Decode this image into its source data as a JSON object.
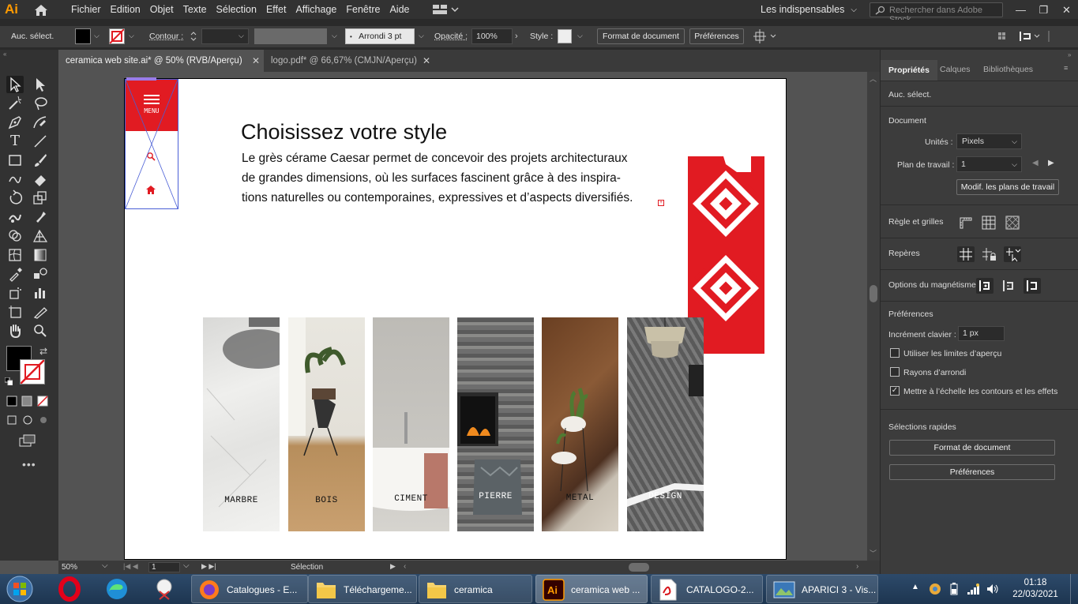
{
  "app": {
    "logo": "Ai",
    "accent": "#ff9a00"
  },
  "menubar": {
    "items": [
      "Fichier",
      "Edition",
      "Objet",
      "Texte",
      "Sélection",
      "Effet",
      "Affichage",
      "Fenêtre",
      "Aide"
    ],
    "workspace": "Les indispensables",
    "search_placeholder": "Rechercher dans Adobe Stock"
  },
  "control_bar": {
    "selection_label": "Auc. sélect.",
    "contour_label": "Contour :",
    "brush": "Arrondi 3 pt",
    "opacity_label": "Opacité :",
    "opacity_value": "100%",
    "style_label": "Style :",
    "doc_format_button": "Format de document",
    "preferences_button": "Préférences"
  },
  "tabs": [
    {
      "label": "ceramica web site.ai* @ 50% (RVB/Aperçu)",
      "active": true
    },
    {
      "label": "logo.pdf* @ 66,67% (CMJN/Aperçu)",
      "active": false
    }
  ],
  "artboard": {
    "menu_label": "MENU",
    "title": "Choisissez votre style",
    "body_lines": [
      "Le grès cérame Caesar permet de concevoir des projets architecturaux",
      "de grandes dimensions, où les surfaces fascinent grâce à des inspira-",
      "tions naturelles ou contemporaines, expressives et d’aspects diversifiés."
    ],
    "brand_color": "#e11b22",
    "tiles": [
      {
        "label": "MARBRE",
        "kind": "marble"
      },
      {
        "label": "BOIS",
        "kind": "wood"
      },
      {
        "label": "CIMENT",
        "kind": "cement"
      },
      {
        "label": "PIERRE",
        "kind": "stone"
      },
      {
        "label": "METAL",
        "kind": "metal"
      },
      {
        "label": "DESIGN",
        "kind": "design"
      }
    ]
  },
  "status": {
    "zoom": "50%",
    "artboard_num": "1",
    "tool": "Sélection"
  },
  "panel": {
    "tabs": [
      "Propriétés",
      "Calques",
      "Bibliothèques"
    ],
    "selection": "Auc. sélect.",
    "document_title": "Document",
    "units_label": "Unités :",
    "units_value": "Pixels",
    "artboard_label": "Plan de travail :",
    "artboard_value": "1",
    "modify_artboards": "Modif. les plans de travail",
    "rulers_grids": "Règle et grilles",
    "guides": "Repères",
    "snap_options": "Options du magnétisme",
    "preferences_title": "Préférences",
    "keyboard_increment_label": "Incrément clavier :",
    "keyboard_increment_value": "1 px",
    "checkboxes": [
      {
        "label": "Utiliser les limites d’aperçu",
        "checked": false
      },
      {
        "label": "Rayons d’arrondi",
        "checked": false
      },
      {
        "label": "Mettre à l’échelle les contours et les effets",
        "checked": true
      }
    ],
    "quick_actions_title": "Sélections rapides",
    "quick_doc_format": "Format de document",
    "quick_preferences": "Préférences"
  },
  "taskbar": {
    "items": [
      {
        "label": "Catalogues - E...",
        "icon": "firefox-icon"
      },
      {
        "label": "Téléchargeme...",
        "icon": "folder-icon"
      },
      {
        "label": "ceramica",
        "icon": "folder-icon"
      },
      {
        "label": "ceramica web ...",
        "icon": "illustrator-icon"
      },
      {
        "label": "CATALOGO-2...",
        "icon": "pdf-icon"
      },
      {
        "label": "APARICI 3 - Vis...",
        "icon": "photo-viewer-icon"
      }
    ],
    "time": "01:18",
    "date": "22/03/2021"
  }
}
